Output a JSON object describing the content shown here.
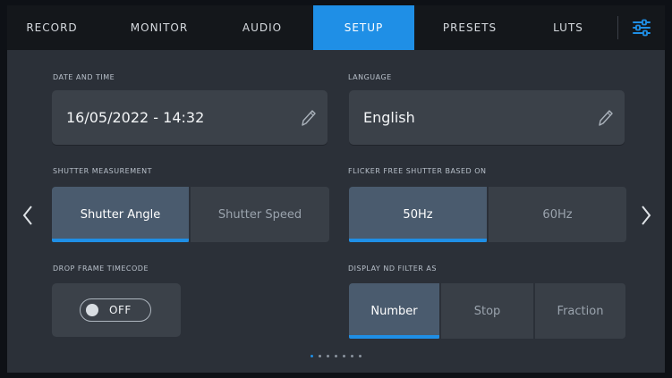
{
  "tabs": [
    {
      "label": "RECORD"
    },
    {
      "label": "MONITOR"
    },
    {
      "label": "AUDIO"
    },
    {
      "label": "SETUP"
    },
    {
      "label": "PRESETS"
    },
    {
      "label": "LUTS"
    }
  ],
  "active_tab": "SETUP",
  "date_time": {
    "label": "DATE AND TIME",
    "value": "16/05/2022 - 14:32"
  },
  "language": {
    "label": "LANGUAGE",
    "value": "English"
  },
  "shutter_measurement": {
    "label": "SHUTTER MEASUREMENT",
    "options": [
      "Shutter Angle",
      "Shutter Speed"
    ],
    "selected": "Shutter Angle"
  },
  "flicker_free": {
    "label": "FLICKER FREE SHUTTER BASED ON",
    "options": [
      "50Hz",
      "60Hz"
    ],
    "selected": "50Hz"
  },
  "drop_frame": {
    "label": "DROP FRAME TIMECODE",
    "state": "OFF"
  },
  "nd_filter": {
    "label": "DISPLAY ND FILTER AS",
    "options": [
      "Number",
      "Stop",
      "Fraction"
    ],
    "selected": "Number"
  },
  "pagination": {
    "total": 7,
    "active": 1
  },
  "colors": {
    "accent": "#1f8fe6",
    "background": "#2b3038",
    "tabbar": "#14171b",
    "field": "#3b4149"
  },
  "icons": [
    "settings-sliders-icon",
    "pencil-icon",
    "chevron-left-icon",
    "chevron-right-icon"
  ]
}
